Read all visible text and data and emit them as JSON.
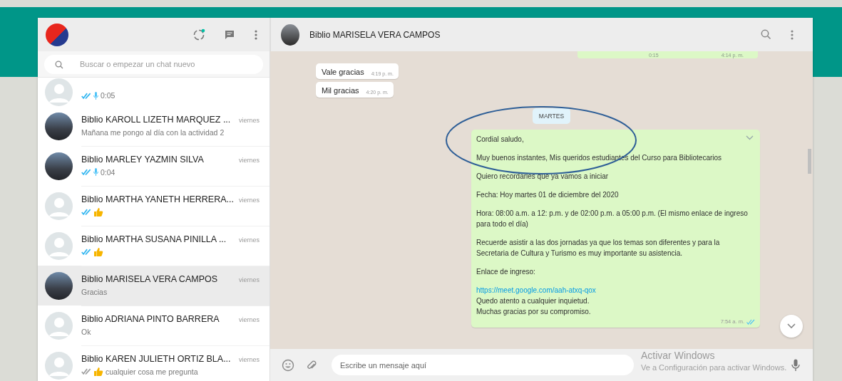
{
  "sidebar": {
    "search": {
      "placeholder": "Buscar o empezar un chat nuevo"
    },
    "chats": [
      {
        "has_photo": false,
        "preview": {
          "delivered": true,
          "read": true,
          "kind": "voice",
          "text": "0:05"
        },
        "selected": false
      },
      {
        "has_photo": true,
        "name": "Biblio KAROLL LIZETH MARQUEZ ...",
        "time": "viernes",
        "preview": {
          "kind": "text",
          "text": "Mañana me pongo al día con la actividad 2"
        },
        "selected": false
      },
      {
        "has_photo": true,
        "name": "Biblio MARLEY YAZMIN SILVA",
        "time": "viernes",
        "preview": {
          "delivered": true,
          "read": true,
          "kind": "voice",
          "text": "0:04"
        },
        "selected": false
      },
      {
        "has_photo": false,
        "name": "Biblio MARTHA YANETH HERRERA...",
        "time": "viernes",
        "preview": {
          "delivered": true,
          "read": true,
          "kind": "thumb"
        },
        "selected": false
      },
      {
        "has_photo": false,
        "name": "Biblio MARTHA SUSANA PINILLA ...",
        "time": "viernes",
        "preview": {
          "delivered": true,
          "read": true,
          "kind": "thumb"
        },
        "selected": false
      },
      {
        "has_photo": true,
        "name": "Biblio MARISELA  VERA CAMPOS",
        "time": "viernes",
        "preview": {
          "kind": "text",
          "text": "Gracias"
        },
        "selected": true
      },
      {
        "has_photo": false,
        "name": "Biblio ADRIANA PINTO BARRERA",
        "time": "viernes",
        "preview": {
          "kind": "text",
          "text": "Ok"
        },
        "selected": false
      },
      {
        "has_photo": false,
        "name": "Biblio KAREN JULIETH ORTIZ BLA...",
        "time": "viernes",
        "preview": {
          "delivered": true,
          "read": false,
          "kind": "thumb",
          "text": "cualquier cosa me pregunta"
        },
        "selected": false
      }
    ]
  },
  "chat": {
    "title": "Biblio MARISELA  VERA CAMPOS",
    "partial_message": {
      "duration": "0:15",
      "time": "4:14 p. m."
    },
    "incoming": [
      {
        "text": "Vale gracias",
        "time": "4:19 p. m."
      },
      {
        "text": "Mil gracias",
        "time": "4:20 p. m."
      }
    ],
    "date_chip": "MARTES",
    "message": {
      "time": "7:54 a. m.",
      "paragraphs": [
        [
          {
            "kind": "text",
            "text": "Cordial saludo,"
          }
        ],
        [
          {
            "kind": "text",
            "text": "Muy buenos instantes, Mis queridos estudiantes del Curso para Bibliotecarios"
          }
        ],
        [
          {
            "kind": "text",
            "text": "Quiero recordarles que ya vamos a iniciar"
          }
        ],
        [
          {
            "kind": "text",
            "text": "Fecha: Hoy martes 01 de diciembre del 2020"
          }
        ],
        [
          {
            "kind": "text",
            "text": "Hora:  08:00 a.m. a 12: p.m. y de 02:00 p.m. a 05:00 p.m. (El mismo enlace de ingreso para todo el día)"
          }
        ],
        [
          {
            "kind": "text",
            "text": "Recuerde asistir a las dos jornadas ya que los temas son diferentes y para la Secretaria de Cultura y Turismo es muy importante su asistencia."
          }
        ],
        [
          {
            "kind": "text",
            "text": "Enlace de ingreso:"
          }
        ],
        [
          {
            "kind": "link",
            "text": "https://meet.google.com/aah-atxq-qox"
          },
          {
            "kind": "text",
            "text": "Quedo atento a cualquier inquietud."
          },
          {
            "kind": "text",
            "text": "Muchas gracias por su compromiso."
          }
        ]
      ]
    },
    "composer": {
      "placeholder": "Escribe un mensaje aquí"
    }
  },
  "windows_notice": {
    "title": "Activar Windows",
    "subtitle": "Ve a Configuración para activar Windows."
  }
}
